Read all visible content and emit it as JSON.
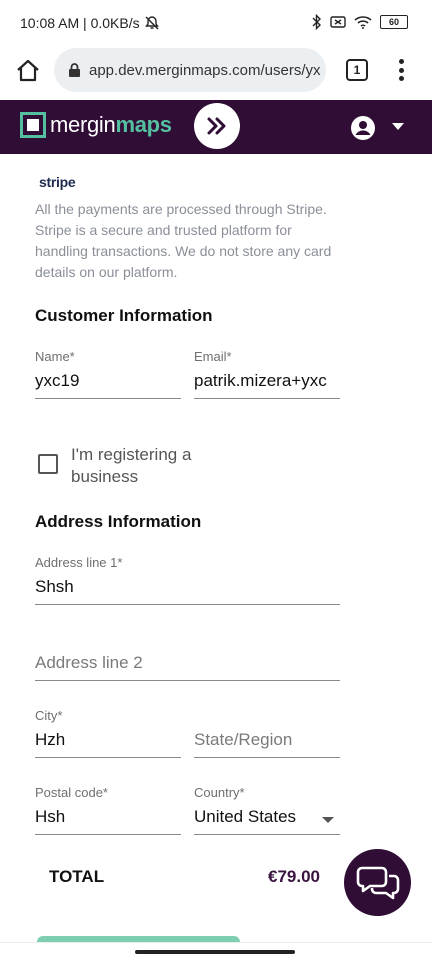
{
  "status_bar": {
    "time_speed": "10:08 AM | 0.0KB/s",
    "battery": "60"
  },
  "browser": {
    "url": "app.dev.merginmaps.com/users/yx",
    "tab_count": "1"
  },
  "header": {
    "logo_part1": "mergin",
    "logo_part2": "maps"
  },
  "payment": {
    "stripe_logo": "stripe",
    "info": "All the payments are processed through Stripe. Stripe is a secure and trusted platform for handling transactions. We do not store any card details on our platform."
  },
  "customer": {
    "title": "Customer Information",
    "name_label": "Name*",
    "name_value": "yxc19",
    "email_label": "Email*",
    "email_value": "patrik.mizera+yxc",
    "business_checkbox": "I'm registering a business"
  },
  "address": {
    "title": "Address Information",
    "line1_label": "Address line 1*",
    "line1_value": "Shsh",
    "line2_placeholder": "Address line 2",
    "city_label": "City*",
    "city_value": "Hzh",
    "state_placeholder": "State/Region",
    "postal_label": "Postal code*",
    "postal_value": "Hsh",
    "country_label": "Country*",
    "country_value": "United States"
  },
  "summary": {
    "total_label": "TOTAL",
    "total_value": "€79.00"
  },
  "colors": {
    "header_bg": "#2f0d35",
    "brand_green": "#55c0a0"
  }
}
